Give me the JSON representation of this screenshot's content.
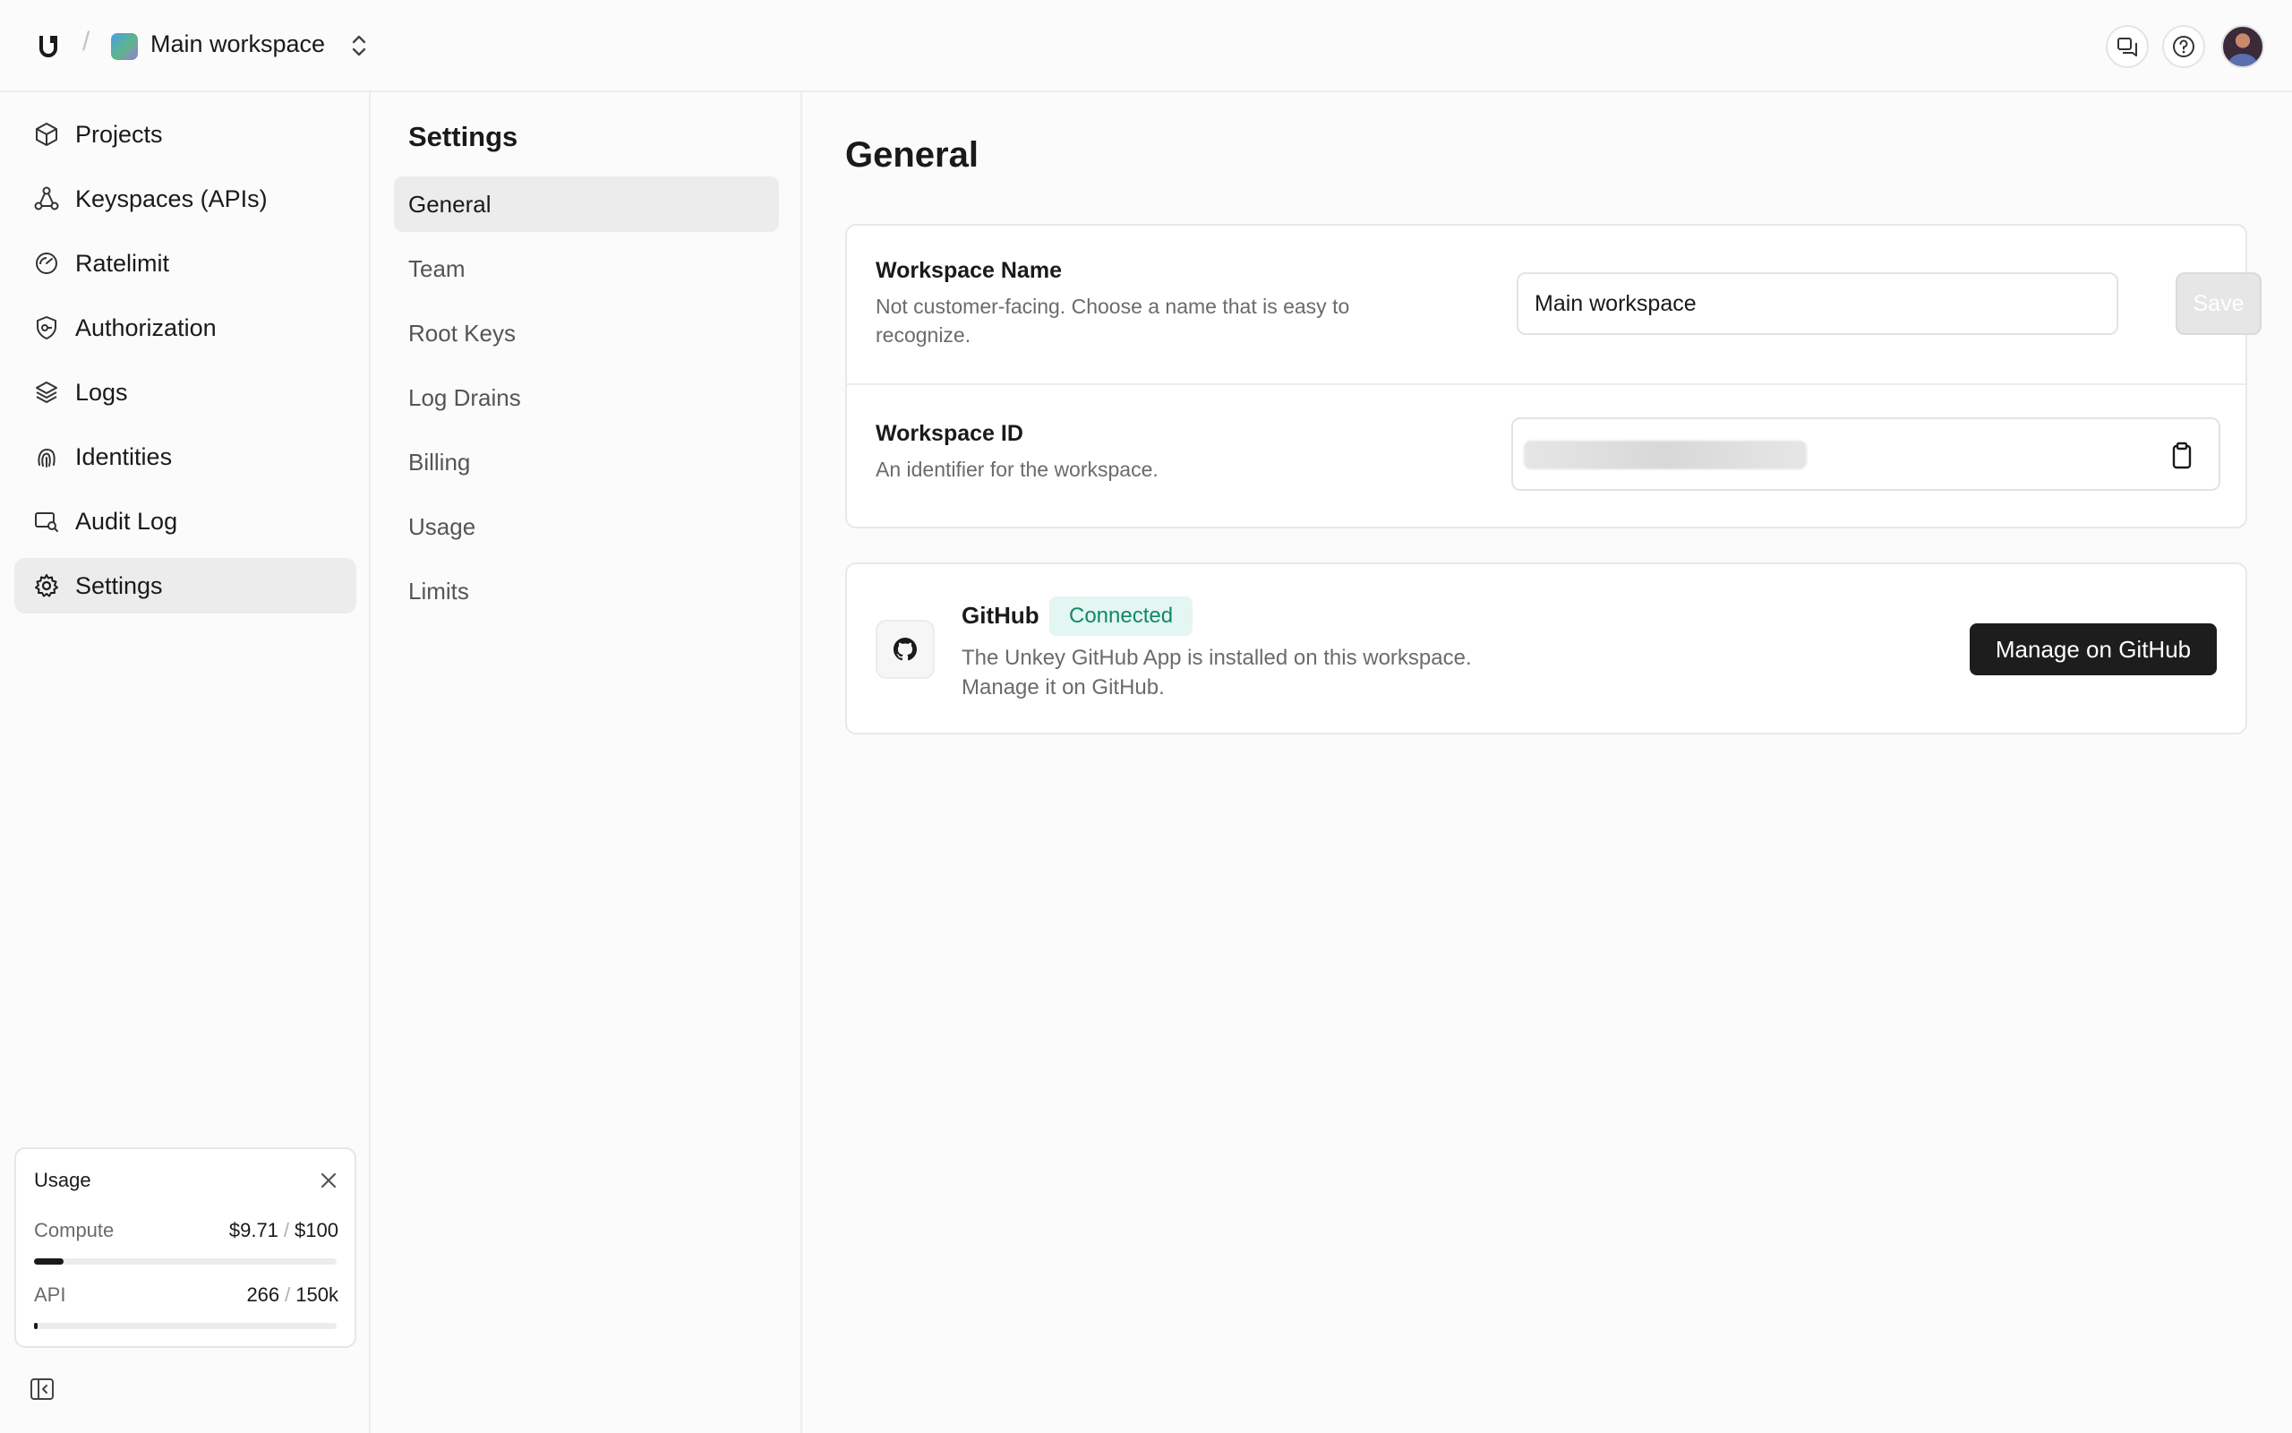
{
  "topbar": {
    "separator": "/",
    "workspace_name": "Main workspace"
  },
  "sidebar": {
    "items": [
      {
        "label": "Projects",
        "icon": "cube-icon"
      },
      {
        "label": "Keyspaces (APIs)",
        "icon": "nodes-icon"
      },
      {
        "label": "Ratelimit",
        "icon": "gauge-icon"
      },
      {
        "label": "Authorization",
        "icon": "shield-key-icon"
      },
      {
        "label": "Logs",
        "icon": "layers-icon"
      },
      {
        "label": "Identities",
        "icon": "fingerprint-icon"
      },
      {
        "label": "Audit Log",
        "icon": "monitor-search-icon"
      },
      {
        "label": "Settings",
        "icon": "gear-icon",
        "active": true
      }
    ],
    "usage": {
      "title": "Usage",
      "compute": {
        "label": "Compute",
        "used": "$9.71",
        "limit": "$100",
        "fraction": 0.0971
      },
      "api": {
        "label": "API",
        "used": "266",
        "limit": "150k",
        "fraction": 0.0018
      },
      "separator": "/"
    }
  },
  "subnav": {
    "title": "Settings",
    "items": [
      {
        "label": "General",
        "active": true
      },
      {
        "label": "Team"
      },
      {
        "label": "Root Keys"
      },
      {
        "label": "Log Drains"
      },
      {
        "label": "Billing"
      },
      {
        "label": "Usage"
      },
      {
        "label": "Limits"
      }
    ]
  },
  "main": {
    "title": "General",
    "workspace_name_section": {
      "title": "Workspace Name",
      "description": "Not customer-facing. Choose a name that is easy to recognize.",
      "input_value": "Main workspace",
      "save_label": "Save"
    },
    "workspace_id_section": {
      "title": "Workspace ID",
      "description": "An identifier for the workspace."
    },
    "github": {
      "title": "GitHub",
      "badge": "Connected",
      "description_line1": "The Unkey GitHub App is installed on this workspace.",
      "description_line2": "Manage it on GitHub.",
      "button_label": "Manage on GitHub"
    }
  },
  "colors": {
    "accent_dark": "#1d1d1d",
    "badge_bg": "#e3f6f1",
    "badge_text": "#12876a"
  }
}
